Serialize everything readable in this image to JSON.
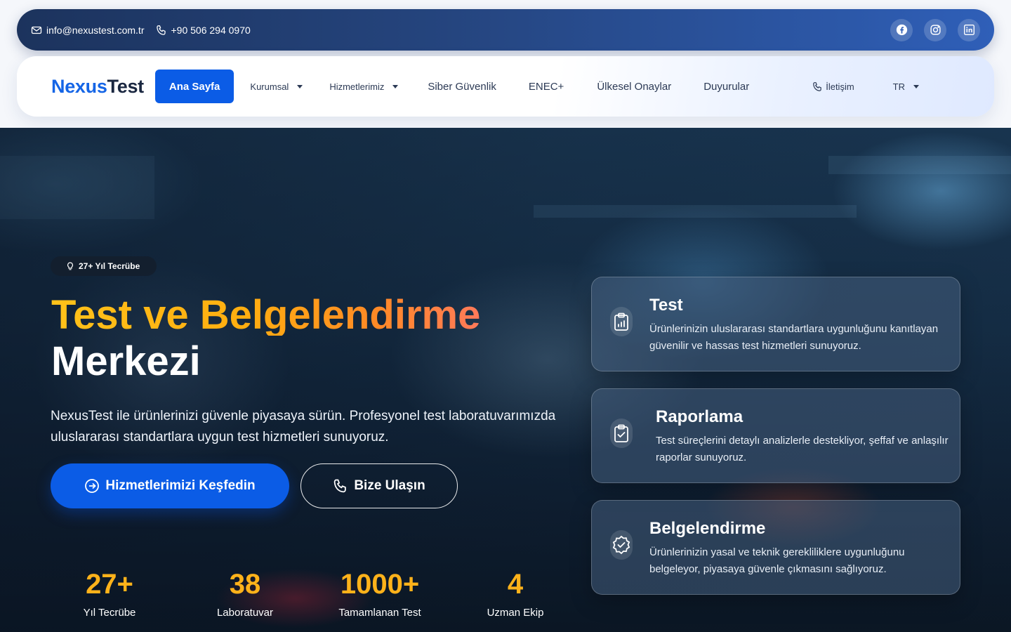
{
  "topbar": {
    "email": "info@nexustest.com.tr",
    "phone": "+90 506 294 0970",
    "socials": [
      "facebook-icon",
      "instagram-icon",
      "linkedin-icon"
    ]
  },
  "nav": {
    "logo_part1": "Nexus",
    "logo_part2": "Test",
    "items": [
      {
        "label": "Ana Sayfa"
      },
      {
        "label": "Kurumsal"
      },
      {
        "label": "Hizmetlerimiz"
      },
      {
        "label": "Siber Güvenlik"
      },
      {
        "label": "ENEC+"
      },
      {
        "label": "Ülkesel Onaylar"
      },
      {
        "label": "Duyurular"
      },
      {
        "label": "İletişim"
      },
      {
        "label": "TR"
      }
    ]
  },
  "hero": {
    "badge": "27+ Yıl Tecrübe",
    "title_line1": "Test ve Belgelendirme",
    "title_line2": "Merkezi",
    "description": "NexusTest ile ürünlerinizi güvenle piyasaya sürün. Profesyonel test laboratuvarımızda uluslararası standartlara uygun test hizmetleri sunuyoruz.",
    "cta_primary": "Hizmetlerimizi Keşfedin",
    "cta_secondary": "Bize Ulaşın",
    "stats": [
      {
        "value": "27+",
        "label": "Yıl Tecrübe"
      },
      {
        "value": "38",
        "label": "Laboratuvar"
      },
      {
        "value": "1000+",
        "label": "Tamamlanan Test"
      },
      {
        "value": "4",
        "label": "Uzman Ekip"
      }
    ],
    "cards": [
      {
        "title": "Test",
        "text": "Ürünlerinizin uluslararası standartlara uygunluğunu kanıtlayan güvenilir ve hassas test hizmetleri sunuyoruz.",
        "icon": "clipboard-chart-icon"
      },
      {
        "title": "Raporlama",
        "text": "Test süreçlerini detaylı analizlerle destekliyor, şeffaf ve anlaşılır raporlar sunuyoruz.",
        "icon": "clipboard-check-icon"
      },
      {
        "title": "Belgelendirme",
        "text": "Ürünlerinizin yasal ve teknik gerekliliklere uygunluğunu belgeleyor, piyasaya güvenle çıkmasını sağlıyoruz.",
        "icon": "badge-check-icon"
      }
    ]
  },
  "colors": {
    "primary": "#0b5ce6",
    "accent": "#ffb21a",
    "topbar_dark": "#1c335d"
  }
}
